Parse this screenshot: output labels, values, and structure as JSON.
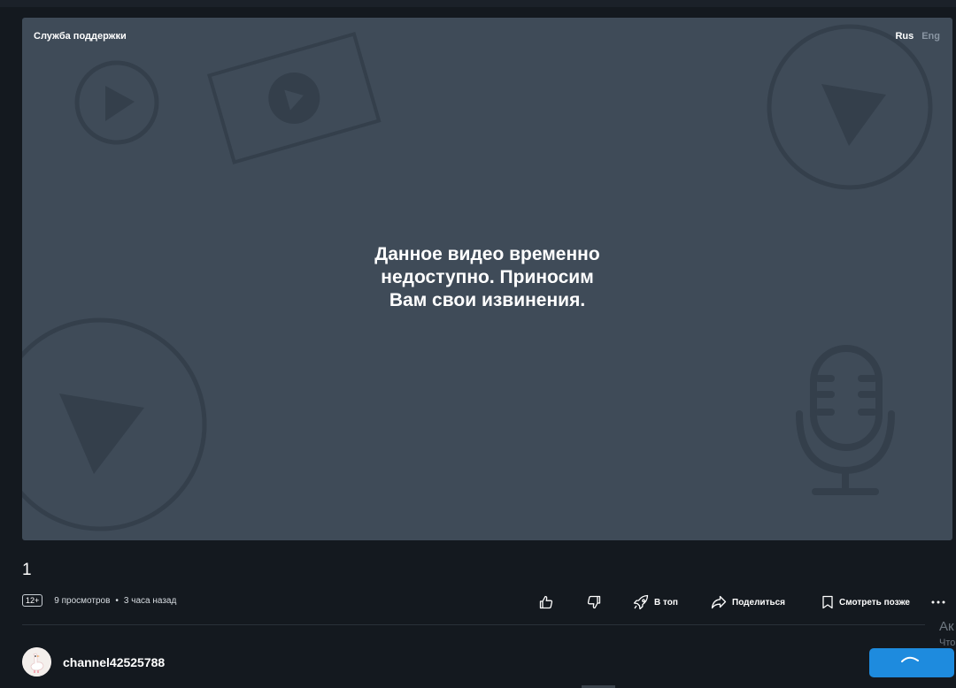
{
  "player": {
    "support_link": "Служба поддержки",
    "languages": {
      "active": "Rus",
      "inactive": "Eng"
    },
    "message_lines": [
      "Данное видео временно",
      "недоступно. Приносим",
      "Вам свои извинения."
    ]
  },
  "video": {
    "title": "1",
    "age_rating": "12+",
    "views": "9 просмотров",
    "separator": "•",
    "published": "3 часа назад"
  },
  "actions": {
    "top_label": "В топ",
    "share_label": "Поделиться",
    "watch_later_label": "Смотреть позже"
  },
  "channel": {
    "name": "channel42525788"
  },
  "side_overlay": {
    "line1": "Ак",
    "line2": "Что"
  },
  "colors": {
    "background": "#14191f",
    "player_bg": "#3f4b58",
    "accent": "#1e8bde"
  },
  "icons": [
    "play-circle-icon",
    "video-frame-icon",
    "microphone-icon",
    "like-icon",
    "dislike-icon",
    "rocket-icon",
    "share-arrow-icon",
    "bookmark-icon",
    "more-dots-icon",
    "spinner-icon"
  ]
}
